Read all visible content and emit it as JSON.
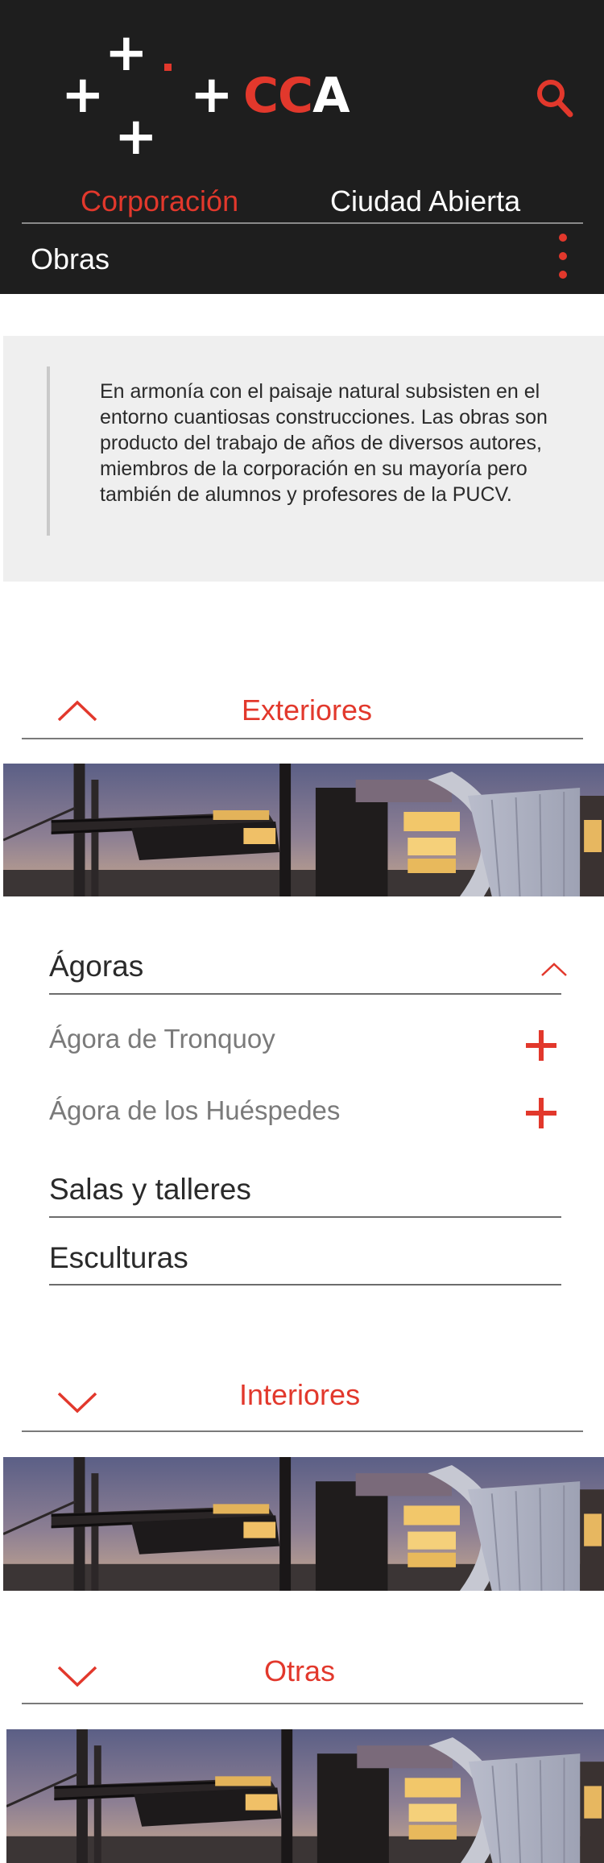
{
  "header": {
    "logo": {
      "text_red": "CC",
      "text_white": "A",
      "plus": "+"
    },
    "tabs": [
      "Corporación",
      "Ciudad Abierta"
    ],
    "current_page": "Obras",
    "search_icon": "search-icon",
    "menu_icon": "kebab-menu-icon"
  },
  "intro": {
    "text": "En armonía con el paisaje natural subsisten en el entorno cuantiosas construcciones. Las obras son producto del trabajo de años de diversos autores, miembros de la corporación en su mayoría pero también de alumnos y profesores de la PUCV."
  },
  "sections": {
    "exteriores": {
      "title": "Exteriores",
      "expanded": true,
      "groups": {
        "agoras": {
          "title": "Ágoras",
          "items": [
            "Ágora de Tronquoy",
            "Ágora de los Huéspedes"
          ]
        },
        "salas": {
          "title": "Salas y talleres"
        },
        "esculturas": {
          "title": "Esculturas"
        }
      }
    },
    "interiores": {
      "title": "Interiores",
      "expanded": false
    },
    "otras": {
      "title": "Otras",
      "expanded": false
    }
  },
  "colors": {
    "accent": "#e2382c",
    "header_bg": "#1e1e1e",
    "intro_bg": "#efefef"
  }
}
